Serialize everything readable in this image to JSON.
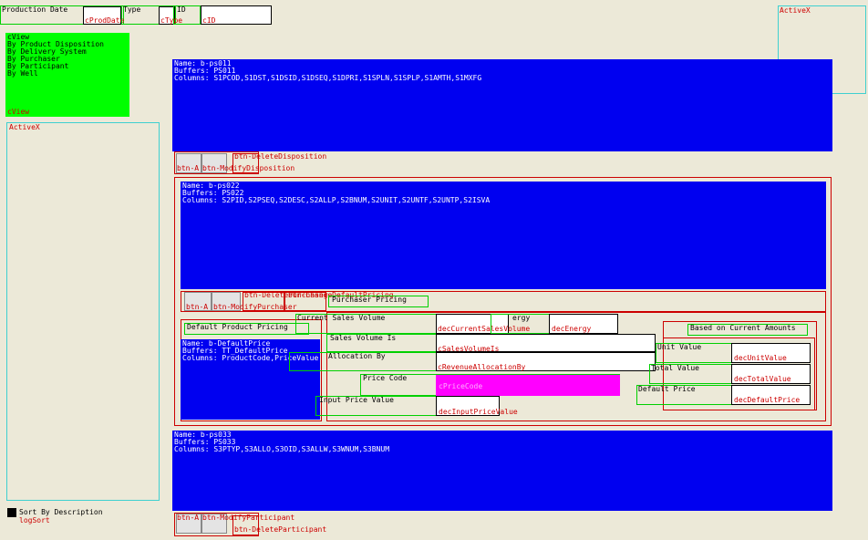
{
  "top": {
    "production_date_label": "Production Date",
    "cprod_date": "cProdDate",
    "type_label": "Type",
    "ctype": "cType",
    "id_label": "ID",
    "cid": "cID"
  },
  "view_list": {
    "header": "cView",
    "items": [
      "By Product Disposition",
      "By Delivery System",
      "By Purchaser",
      "By Participant",
      "By Well"
    ],
    "footer": "cView"
  },
  "activex_left": "ActiveX",
  "activex_right": "ActiveX",
  "sort": {
    "label": "Sort By Description",
    "name": "logSort"
  },
  "browse1": {
    "name": "Name: b-ps011",
    "buffers": "Buffers: PS011",
    "columns": "Columns: S1PCOD,S1DST,S1DSID,S1DSEQ,S1DPRI,S1SPLN,S1SPLP,S1AMTH,S1MXFG"
  },
  "browse1_buttons": {
    "add": "btn-A",
    "modify": "btn-ModifyDisposition",
    "delete": "btn-DeleteDisposition"
  },
  "browse2": {
    "name": "Name: b-ps022",
    "buffers": "Buffers: PS022",
    "columns": "Columns: S2PID,S2PSEQ,S2DESC,S2ALLP,S2BNUM,S2UNIT,S2UNTF,S2UNTP,S2ISVA"
  },
  "browse2_buttons": {
    "add": "btn-A",
    "modify": "btn-ModifyPurchaser",
    "delete": "btn-DeletePurchaser",
    "overlap": "btn-ChangeDefaultPricing"
  },
  "purchaser_pricing": "Purchaser Pricing",
  "default_product_pricing": "Default Product Pricing",
  "browse3": {
    "name": "Name: b-DefaultPrice",
    "buffers": "Buffers: TT_DefaultPrice",
    "columns": "Columns: ProductCode,PriceValue"
  },
  "pricing": {
    "current_sales_volume_label": "Current Sales Volume",
    "dec_current_sales_volume": "decCurrentSalesVolume",
    "energy_label": "ergy",
    "dec_energy": "decEnergy",
    "sales_volume_is_label": "Sales Volume Is",
    "c_sales_volume_is": "cSalesVolumeIs",
    "allocation_by_label": "Allocation By",
    "c_revenue_allocation_by": "cRevenueAllocationBy",
    "price_code_label": "Price Code",
    "c_price_code": "cPriceCode",
    "input_price_value_label": "Input Price Value",
    "dec_input_price_value": "decInputPriceValue",
    "based_on_label": "Based on Current Amounts",
    "unit_value_label": "Unit Value",
    "dec_unit_value": "decUnitValue",
    "total_value_label": "Total Value",
    "dec_total_value": "decTotalValue",
    "default_price_label": "Default Price",
    "dec_default_price": "decDefaultPrice"
  },
  "browse4": {
    "name": "Name: b-ps033",
    "buffers": "Buffers: PS033",
    "columns": "Columns: S3PTYP,S3ALLO,S3OID,S3ALLW,S3WNUM,S3BNUM"
  },
  "browse4_buttons": {
    "add": "btn-A",
    "modify": "btn-ModifyParticipant",
    "delete": "btn-DeleteParticipant"
  }
}
